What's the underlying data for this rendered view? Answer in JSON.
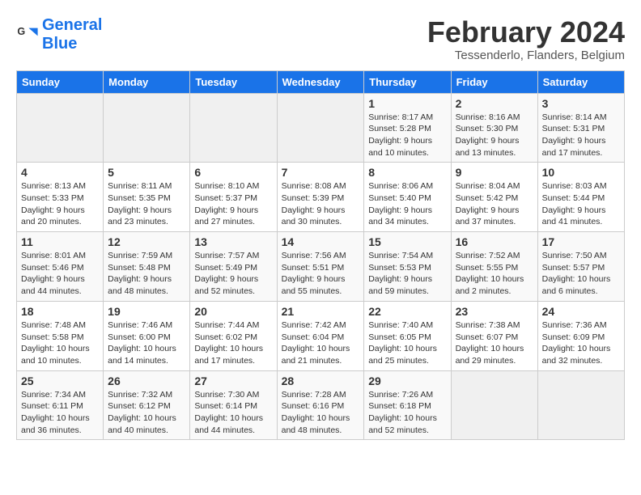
{
  "logo": {
    "text_general": "General",
    "text_blue": "Blue"
  },
  "header": {
    "month": "February 2024",
    "location": "Tessenderlo, Flanders, Belgium"
  },
  "weekdays": [
    "Sunday",
    "Monday",
    "Tuesday",
    "Wednesday",
    "Thursday",
    "Friday",
    "Saturday"
  ],
  "weeks": [
    [
      {
        "day": "",
        "info": ""
      },
      {
        "day": "",
        "info": ""
      },
      {
        "day": "",
        "info": ""
      },
      {
        "day": "",
        "info": ""
      },
      {
        "day": "1",
        "info": "Sunrise: 8:17 AM\nSunset: 5:28 PM\nDaylight: 9 hours\nand 10 minutes."
      },
      {
        "day": "2",
        "info": "Sunrise: 8:16 AM\nSunset: 5:30 PM\nDaylight: 9 hours\nand 13 minutes."
      },
      {
        "day": "3",
        "info": "Sunrise: 8:14 AM\nSunset: 5:31 PM\nDaylight: 9 hours\nand 17 minutes."
      }
    ],
    [
      {
        "day": "4",
        "info": "Sunrise: 8:13 AM\nSunset: 5:33 PM\nDaylight: 9 hours\nand 20 minutes."
      },
      {
        "day": "5",
        "info": "Sunrise: 8:11 AM\nSunset: 5:35 PM\nDaylight: 9 hours\nand 23 minutes."
      },
      {
        "day": "6",
        "info": "Sunrise: 8:10 AM\nSunset: 5:37 PM\nDaylight: 9 hours\nand 27 minutes."
      },
      {
        "day": "7",
        "info": "Sunrise: 8:08 AM\nSunset: 5:39 PM\nDaylight: 9 hours\nand 30 minutes."
      },
      {
        "day": "8",
        "info": "Sunrise: 8:06 AM\nSunset: 5:40 PM\nDaylight: 9 hours\nand 34 minutes."
      },
      {
        "day": "9",
        "info": "Sunrise: 8:04 AM\nSunset: 5:42 PM\nDaylight: 9 hours\nand 37 minutes."
      },
      {
        "day": "10",
        "info": "Sunrise: 8:03 AM\nSunset: 5:44 PM\nDaylight: 9 hours\nand 41 minutes."
      }
    ],
    [
      {
        "day": "11",
        "info": "Sunrise: 8:01 AM\nSunset: 5:46 PM\nDaylight: 9 hours\nand 44 minutes."
      },
      {
        "day": "12",
        "info": "Sunrise: 7:59 AM\nSunset: 5:48 PM\nDaylight: 9 hours\nand 48 minutes."
      },
      {
        "day": "13",
        "info": "Sunrise: 7:57 AM\nSunset: 5:49 PM\nDaylight: 9 hours\nand 52 minutes."
      },
      {
        "day": "14",
        "info": "Sunrise: 7:56 AM\nSunset: 5:51 PM\nDaylight: 9 hours\nand 55 minutes."
      },
      {
        "day": "15",
        "info": "Sunrise: 7:54 AM\nSunset: 5:53 PM\nDaylight: 9 hours\nand 59 minutes."
      },
      {
        "day": "16",
        "info": "Sunrise: 7:52 AM\nSunset: 5:55 PM\nDaylight: 10 hours\nand 2 minutes."
      },
      {
        "day": "17",
        "info": "Sunrise: 7:50 AM\nSunset: 5:57 PM\nDaylight: 10 hours\nand 6 minutes."
      }
    ],
    [
      {
        "day": "18",
        "info": "Sunrise: 7:48 AM\nSunset: 5:58 PM\nDaylight: 10 hours\nand 10 minutes."
      },
      {
        "day": "19",
        "info": "Sunrise: 7:46 AM\nSunset: 6:00 PM\nDaylight: 10 hours\nand 14 minutes."
      },
      {
        "day": "20",
        "info": "Sunrise: 7:44 AM\nSunset: 6:02 PM\nDaylight: 10 hours\nand 17 minutes."
      },
      {
        "day": "21",
        "info": "Sunrise: 7:42 AM\nSunset: 6:04 PM\nDaylight: 10 hours\nand 21 minutes."
      },
      {
        "day": "22",
        "info": "Sunrise: 7:40 AM\nSunset: 6:05 PM\nDaylight: 10 hours\nand 25 minutes."
      },
      {
        "day": "23",
        "info": "Sunrise: 7:38 AM\nSunset: 6:07 PM\nDaylight: 10 hours\nand 29 minutes."
      },
      {
        "day": "24",
        "info": "Sunrise: 7:36 AM\nSunset: 6:09 PM\nDaylight: 10 hours\nand 32 minutes."
      }
    ],
    [
      {
        "day": "25",
        "info": "Sunrise: 7:34 AM\nSunset: 6:11 PM\nDaylight: 10 hours\nand 36 minutes."
      },
      {
        "day": "26",
        "info": "Sunrise: 7:32 AM\nSunset: 6:12 PM\nDaylight: 10 hours\nand 40 minutes."
      },
      {
        "day": "27",
        "info": "Sunrise: 7:30 AM\nSunset: 6:14 PM\nDaylight: 10 hours\nand 44 minutes."
      },
      {
        "day": "28",
        "info": "Sunrise: 7:28 AM\nSunset: 6:16 PM\nDaylight: 10 hours\nand 48 minutes."
      },
      {
        "day": "29",
        "info": "Sunrise: 7:26 AM\nSunset: 6:18 PM\nDaylight: 10 hours\nand 52 minutes."
      },
      {
        "day": "",
        "info": ""
      },
      {
        "day": "",
        "info": ""
      }
    ]
  ]
}
